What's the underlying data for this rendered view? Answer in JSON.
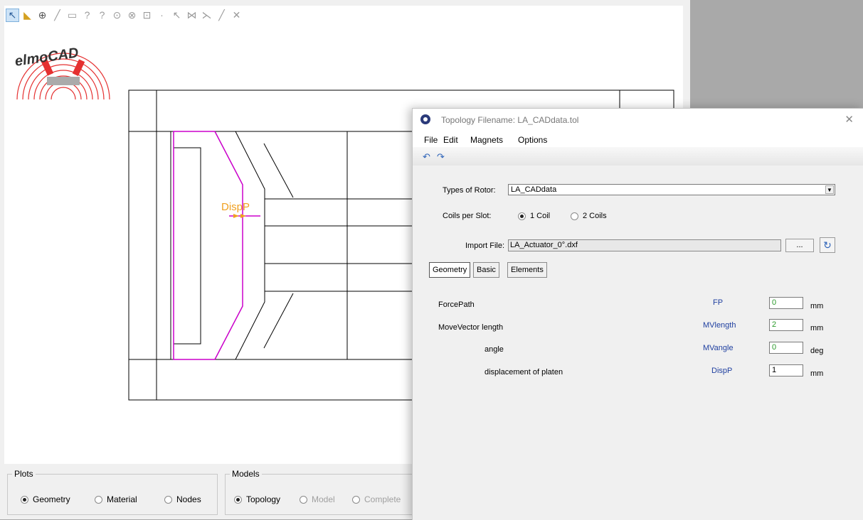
{
  "toolbar": {
    "icons": [
      "select-arrow-icon",
      "triangle-icon",
      "zoom-icon",
      "line-icon",
      "rectangle-icon",
      "arc-icon",
      "arc2-icon",
      "circle-icon",
      "measure-icon",
      "zoom-window-icon",
      "point-icon",
      "pointer-icon",
      "multi-icon",
      "cross-icon",
      "diagonal-icon",
      "delete-icon"
    ]
  },
  "logo": {
    "text": "elmoCAD"
  },
  "drawing": {
    "annotation_label": "DispP",
    "annotation_color": "#f0a020",
    "contour_color": "#cc00cc"
  },
  "plots": {
    "title": "Plots",
    "options": [
      {
        "label": "Geometry",
        "selected": true
      },
      {
        "label": "Material",
        "selected": false
      },
      {
        "label": "Nodes",
        "selected": false
      }
    ]
  },
  "models": {
    "title": "Models",
    "options": [
      {
        "label": "Topology",
        "selected": true,
        "enabled": true
      },
      {
        "label": "Model",
        "selected": false,
        "enabled": false
      },
      {
        "label": "Complete",
        "selected": false,
        "enabled": false
      }
    ]
  },
  "dialog": {
    "title": "Topology Filename: LA_CADdata.tol",
    "menu": [
      "File",
      "Edit",
      "Magnets",
      "Options"
    ],
    "rotor_label": "Types of Rotor:",
    "rotor_value": "LA_CADdata",
    "coils_label": "Coils per Slot:",
    "coil_options": [
      {
        "label": "1 Coil",
        "selected": true
      },
      {
        "label": "2 Coils",
        "selected": false
      }
    ],
    "import_label": "Import File:",
    "import_value": "LA_Actuator_0°.dxf",
    "browse_label": "...",
    "tabs": [
      "Geometry",
      "Basic",
      "Elements"
    ],
    "params": [
      {
        "label": "ForcePath",
        "symbol": "FP",
        "value": "0",
        "unit": "mm"
      },
      {
        "label": "MoveVector length",
        "symbol": "MVlength",
        "value": "2",
        "unit": "mm"
      },
      {
        "label": "angle",
        "symbol": "MVangle",
        "value": "0",
        "unit": "deg"
      },
      {
        "label": "displacement of platen",
        "symbol": "DispP",
        "value": "1",
        "unit": "mm"
      }
    ]
  }
}
